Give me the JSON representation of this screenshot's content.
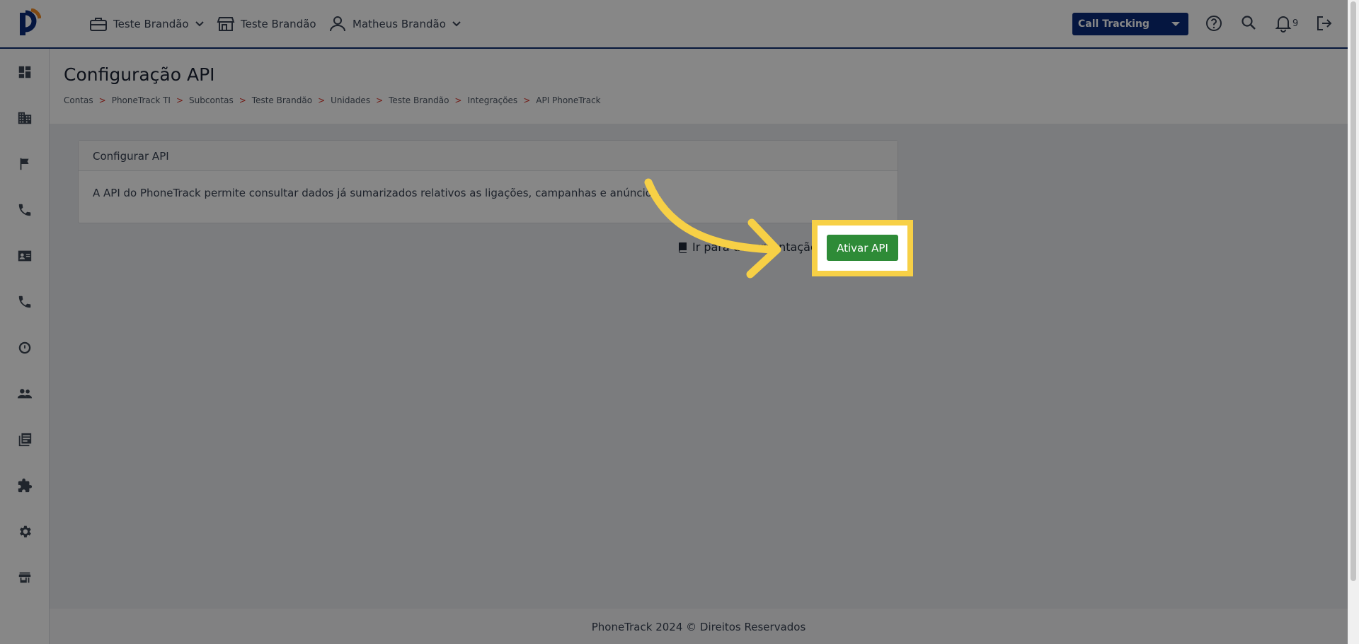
{
  "topbar": {
    "account_label": "Teste Brandão",
    "unit_label": "Teste Brandão",
    "user_label": "Matheus Brandão",
    "product_select": "Call Tracking",
    "notification_count": "9"
  },
  "page": {
    "title": "Configuração API",
    "breadcrumb": [
      "Contas",
      "PhoneTrack TI",
      "Subcontas",
      "Teste Brandão",
      "Unidades",
      "Teste Brandão",
      "Integrações",
      "API PhoneTrack"
    ],
    "breadcrumb_sep": ">"
  },
  "card": {
    "title": "Configurar API",
    "description": "A API do PhoneTrack permite consultar dados já sumarizados relativos as ligações, campanhas e anúncios."
  },
  "actions": {
    "doc_link": "Ir para documentação",
    "activate_button": "Ativar API"
  },
  "footer": {
    "text": "PhoneTrack 2024 © Direitos Reservados"
  },
  "colors": {
    "brand_blue": "#0b2a7a",
    "accent_green": "#2e8b37",
    "highlight_yellow": "#f7d046"
  }
}
